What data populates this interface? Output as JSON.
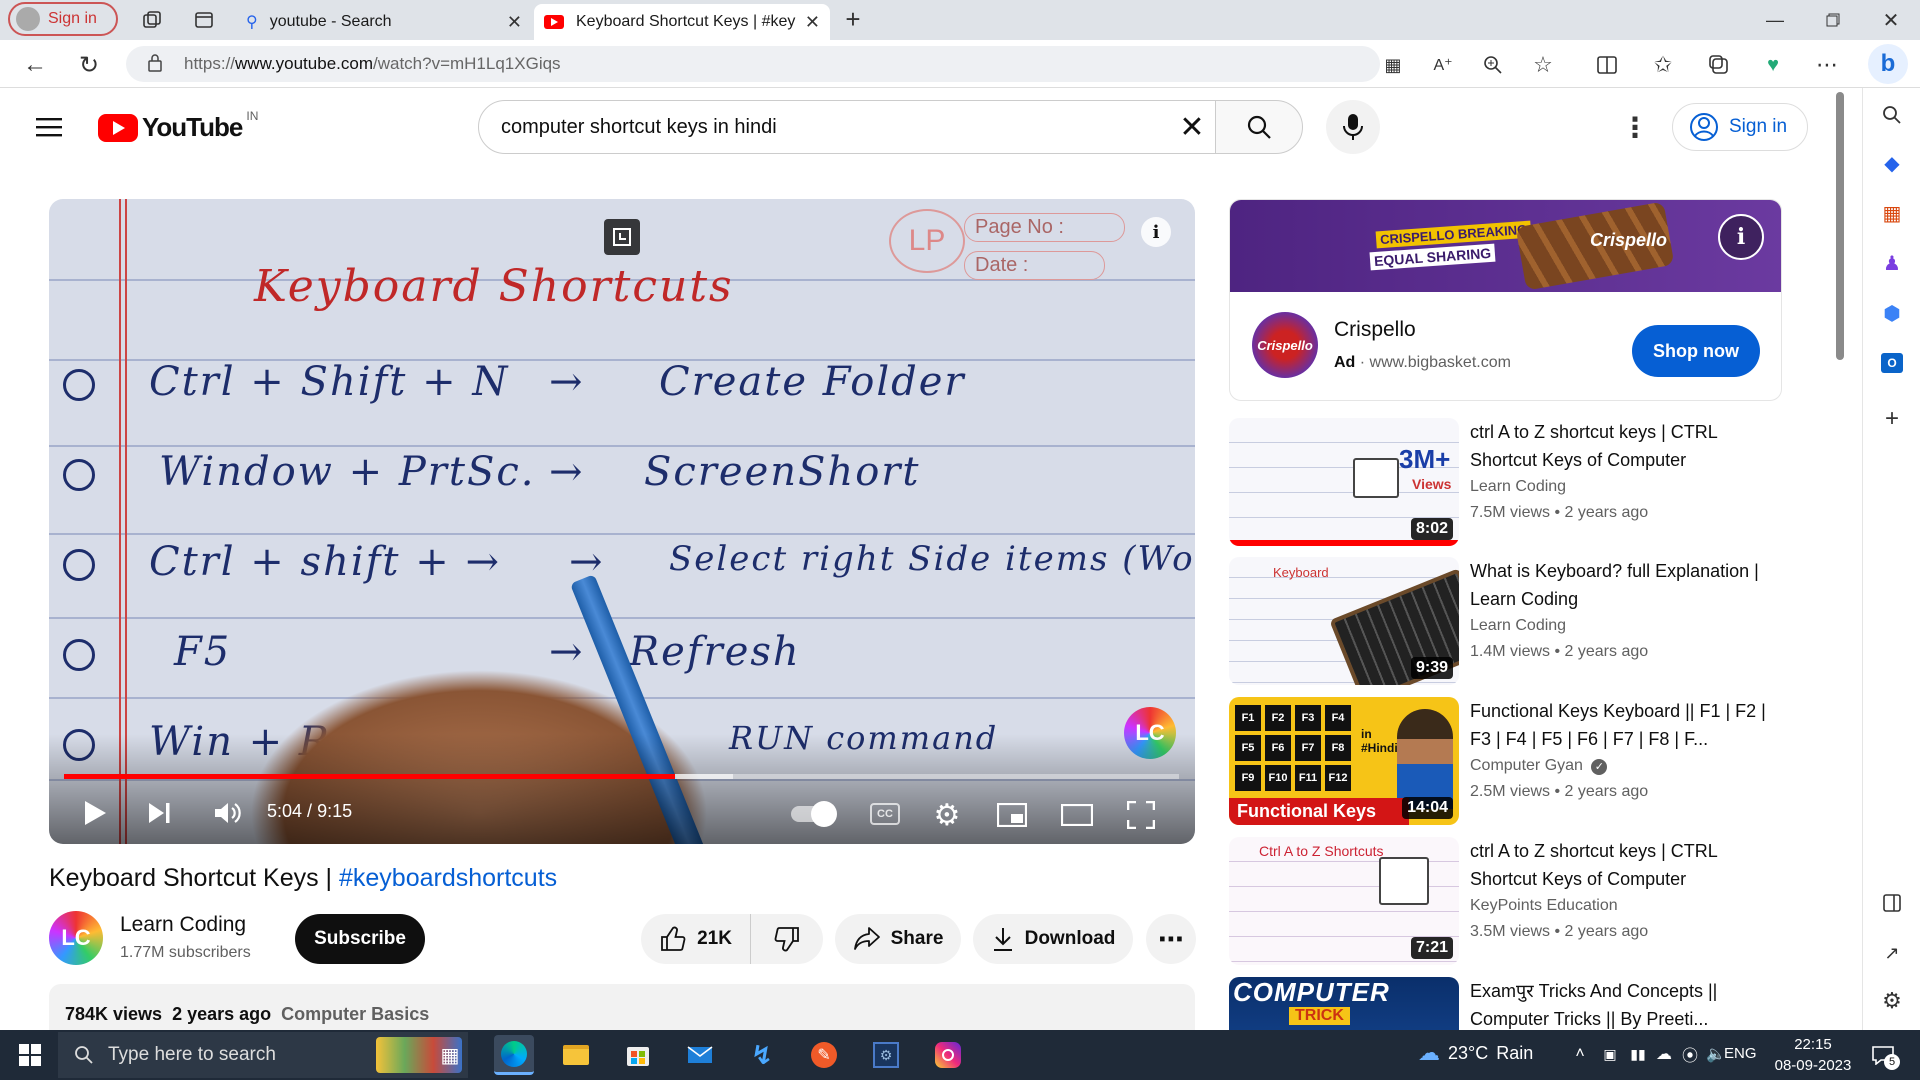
{
  "browser": {
    "profile_label": "Sign in",
    "tabs": [
      {
        "label": "youtube - Search"
      },
      {
        "label": "Keyboard Shortcut Keys | #keybo"
      }
    ],
    "url_prefix": "https://",
    "url_host": "www.youtube.com",
    "url_path": "/watch?v=mH1Lq1XGiqs"
  },
  "youtube": {
    "logo_text": "YouTube",
    "region": "IN",
    "search_value": "computer shortcut keys in hindi",
    "signin_label": "Sign in"
  },
  "player": {
    "time_current": "5:04",
    "time_sep": " / ",
    "time_total": "9:15",
    "progress_fraction": 0.548,
    "buffered_fraction": 0.6,
    "board": {
      "title": "Keyboard Shortcuts",
      "page_no": "Page No :",
      "date": "Date :",
      "rows": [
        {
          "keys": "Ctrl + Shift + N",
          "arrow": "→",
          "action": "Create Folder"
        },
        {
          "keys": "Window + PrtSc.",
          "arrow": "→",
          "action": "ScreenShort"
        },
        {
          "keys": "Ctrl + shift + →",
          "arrow": "→",
          "action": "Select right Side items (Word)"
        },
        {
          "keys": "F5",
          "arrow": "→",
          "action": "Refresh"
        },
        {
          "keys": "Win + R",
          "arrow": "",
          "action": "RUN command"
        }
      ],
      "watermark": "LC"
    }
  },
  "video": {
    "title_plain": "Keyboard Shortcut Keys | ",
    "title_hashtag": "#keyboardshortcuts",
    "channel_name": "Learn Coding",
    "subscribers": "1.77M subscribers",
    "subscribe_label": "Subscribe",
    "likes": "21K",
    "share_label": "Share",
    "download_label": "Download",
    "views": "784K views",
    "age": "2 years ago",
    "category": "Computer Basics",
    "avatar_text": "LC"
  },
  "ad": {
    "banner_line1": "CRISPELLO BREAKING",
    "banner_line2": "EQUAL SHARING",
    "brand": "Crispello",
    "badge": "Ad",
    "sep": " · ",
    "domain": "www.bigbasket.com",
    "cta": "Shop now",
    "colors": {
      "banner": "#5a2d8c",
      "cta": "#065fd4"
    }
  },
  "recommendations": [
    {
      "title": "ctrl A to Z shortcut keys | CTRL Shortcut Keys of Computer",
      "channel": "Learn Coding",
      "views": "7.5M views",
      "age": "2 years ago",
      "duration": "8:02",
      "thumb_text": "3M+",
      "thumb_sub": "Views"
    },
    {
      "title": "What is Keyboard? full Explanation | Learn Coding",
      "channel": "Learn Coding",
      "views": "1.4M views",
      "age": "2 years ago",
      "duration": "9:39",
      "thumb_text": "Keyboard"
    },
    {
      "title": "Functional Keys Keyboard || F1 | F2 | F3 | F4 | F5 | F6 | F7 | F8 | F...",
      "channel": "Computer Gyan",
      "views": "2.5M views",
      "age": "2 years ago",
      "duration": "14:04",
      "thumb_text": "Functional Keys",
      "thumb_sub": "in #Hindi",
      "verified": true
    },
    {
      "title": "ctrl A to Z shortcut keys | CTRL Shortcut Keys of Computer",
      "channel": "KeyPoints Education",
      "views": "3.5M views",
      "age": "2 years ago",
      "duration": "7:21",
      "thumb_text": "Ctrl A to Z Shortcuts"
    },
    {
      "title": "Examपुर Tricks And Concepts || Computer Tricks || By Preeti...",
      "channel": "",
      "views": "",
      "age": "",
      "duration": "",
      "thumb_text": "COMPUTER",
      "thumb_sub": "TRICK"
    }
  ],
  "taskbar": {
    "search_placeholder": "Type here to search",
    "weather_temp": "23°C",
    "weather_desc": "Rain",
    "lang": "ENG",
    "time": "22:15",
    "date": "08-09-2023",
    "notif_count": "5"
  },
  "icons": [
    "hamburger-icon",
    "youtube-logo-icon",
    "close-icon",
    "search-icon",
    "mic-icon",
    "more-vert-icon",
    "account-icon",
    "play-icon",
    "next-icon",
    "volume-icon",
    "autoplay-icon",
    "cc-icon",
    "settings-icon",
    "miniplayer-icon",
    "theater-icon",
    "fullscreen-icon",
    "like-icon",
    "dislike-icon",
    "share-icon",
    "download-icon",
    "more-horiz-icon",
    "info-icon",
    "verified-icon"
  ]
}
